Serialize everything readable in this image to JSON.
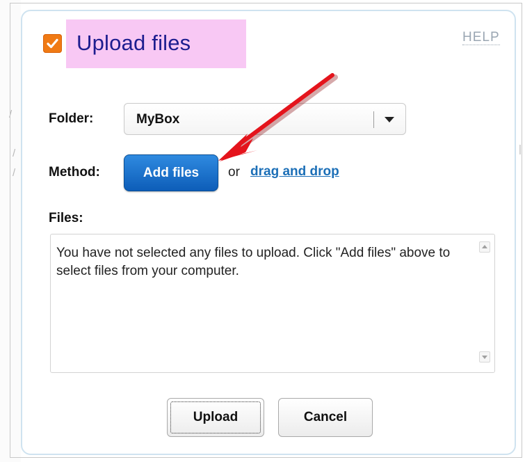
{
  "dialog": {
    "title": "Upload files",
    "help_label": "HELP",
    "accent_color": "#f07a14",
    "title_highlight_color": "#f8c8f4"
  },
  "folder": {
    "label": "Folder:",
    "selected": "MyBox",
    "dropdown_icon": "chevron-down-icon"
  },
  "method": {
    "label": "Method:",
    "add_files_label": "Add files",
    "or_text": "or",
    "drag_drop_label": "drag and drop"
  },
  "files": {
    "label": "Files:",
    "message": "You have not selected any files to upload. Click \"Add files\" above to select files from your computer."
  },
  "actions": {
    "upload_label": "Upload",
    "cancel_label": "Cancel"
  },
  "annotation": {
    "arrow_color": "#e4141c"
  }
}
